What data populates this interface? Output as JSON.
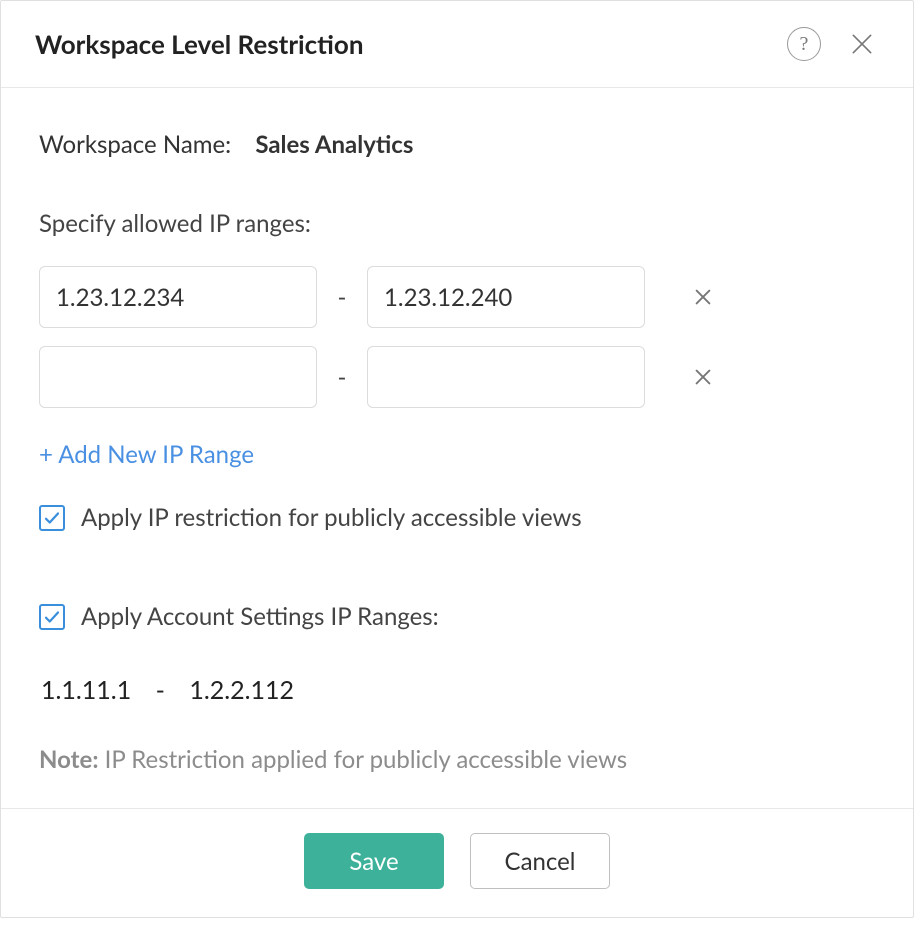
{
  "header": {
    "title": "Workspace Level Restriction",
    "help_glyph": "?"
  },
  "workspace": {
    "label": "Workspace Name:",
    "name": "Sales Analytics"
  },
  "ip_section": {
    "label": "Specify allowed IP ranges:",
    "rows": [
      {
        "from": "1.23.12.234",
        "to": "1.23.12.240"
      },
      {
        "from": "",
        "to": ""
      }
    ],
    "dash": "-",
    "add_label": "+ Add New IP Range"
  },
  "options": {
    "apply_public": {
      "checked": true,
      "label": "Apply IP restriction for publicly accessible views"
    },
    "apply_account": {
      "checked": true,
      "label": "Apply Account Settings IP Ranges:"
    }
  },
  "account_range": {
    "from": "1.1.11.1",
    "dash": "-",
    "to": "1.2.2.112"
  },
  "note": {
    "prefix": "Note:",
    "text": " IP Restriction applied for publicly accessible views"
  },
  "footer": {
    "save": "Save",
    "cancel": "Cancel"
  }
}
